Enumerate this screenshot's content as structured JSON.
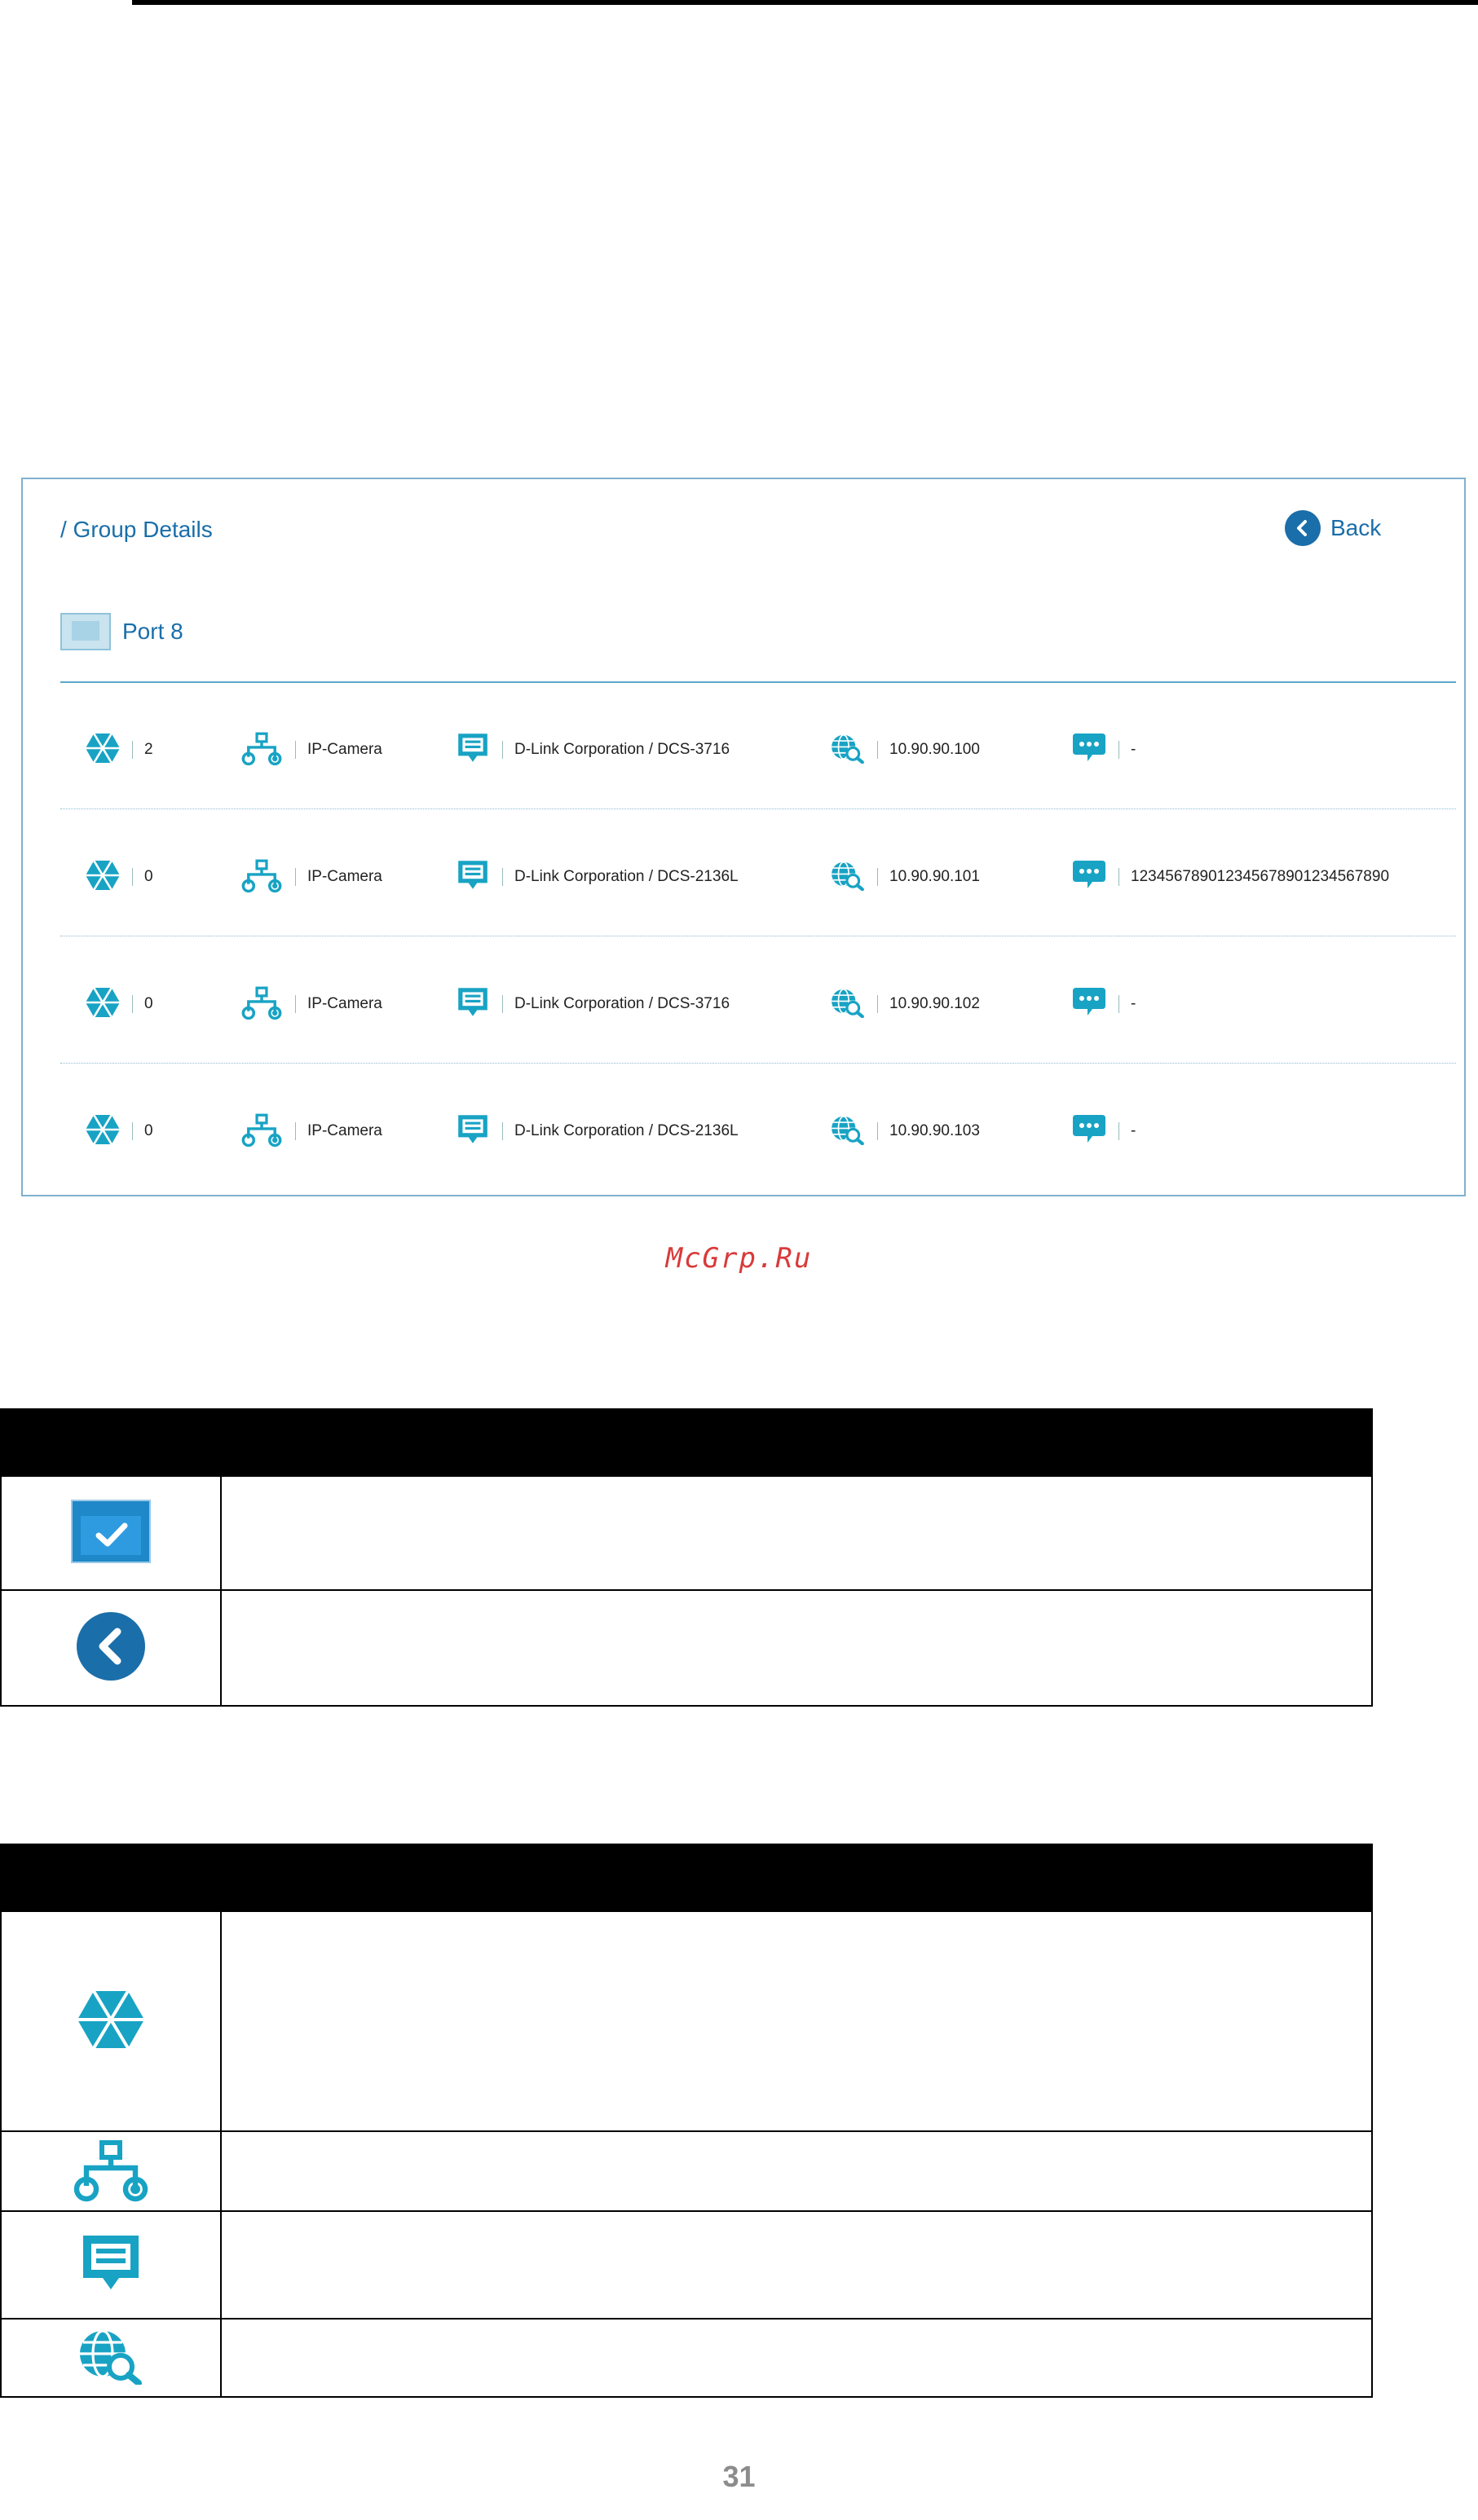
{
  "header_label": "/ Group Details",
  "back_label": "Back",
  "port_label": "Port 8",
  "rows": [
    {
      "count": "2",
      "type": "IP-Camera",
      "vendor": "D-Link Corporation / DCS-3716",
      "ip": "10.90.90.100",
      "note": "-"
    },
    {
      "count": "0",
      "type": "IP-Camera",
      "vendor": "D-Link Corporation / DCS-2136L",
      "ip": "10.90.90.101",
      "note": "123456789012345678901234567890"
    },
    {
      "count": "0",
      "type": "IP-Camera",
      "vendor": "D-Link Corporation / DCS-3716",
      "ip": "10.90.90.102",
      "note": "-"
    },
    {
      "count": "0",
      "type": "IP-Camera",
      "vendor": "D-Link Corporation / DCS-2136L",
      "ip": "10.90.90.103",
      "note": "-"
    }
  ],
  "watermark": "McGrp.Ru",
  "page_number": "31",
  "colors": {
    "accent": "#1a6ea9",
    "teal": "#18a3c4",
    "port_fill": "#c9e3ef"
  },
  "icons": [
    "back-icon",
    "port-icon",
    "poe-icon",
    "device-type-icon",
    "vendor-icon",
    "ip-search-icon",
    "description-icon",
    "select-checkbox-icon"
  ]
}
